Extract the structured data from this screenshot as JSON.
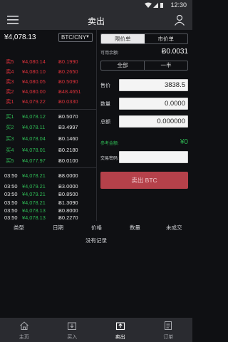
{
  "status": {
    "time": "12:30"
  },
  "header": {
    "title": "卖出"
  },
  "market": {
    "last_price": "¥4,078.13",
    "pair": "BTC/CNY"
  },
  "asks": [
    {
      "label": "卖5",
      "price": "¥4,080.14",
      "qty": "Ƀ0.1990"
    },
    {
      "label": "卖4",
      "price": "¥4,080.10",
      "qty": "Ƀ0.2650"
    },
    {
      "label": "卖3",
      "price": "¥4,080.05",
      "qty": "Ƀ0.5090"
    },
    {
      "label": "卖2",
      "price": "¥4,080.00",
      "qty": "Ƀ48.4651"
    },
    {
      "label": "卖1",
      "price": "¥4,079.22",
      "qty": "Ƀ0.0330"
    }
  ],
  "bids": [
    {
      "label": "买1",
      "price": "¥4,078.12",
      "qty": "Ƀ0.5070"
    },
    {
      "label": "买2",
      "price": "¥4,078.11",
      "qty": "Ƀ3.4997"
    },
    {
      "label": "买3",
      "price": "¥4,078.04",
      "qty": "Ƀ0.1460"
    },
    {
      "label": "买4",
      "price": "¥4,078.01",
      "qty": "Ƀ0.2180"
    },
    {
      "label": "买5",
      "price": "¥4,077.97",
      "qty": "Ƀ0.0100"
    }
  ],
  "trades": [
    {
      "time": "03:50",
      "price": "¥4,078.21",
      "qty": "Ƀ8.0000"
    },
    {
      "time": "03:50",
      "price": "¥4,079.21",
      "qty": "Ƀ3.0000"
    },
    {
      "time": "03:50",
      "price": "¥4,079.21",
      "qty": "Ƀ0.8500"
    },
    {
      "time": "03:50",
      "price": "¥4,078.21",
      "qty": "Ƀ1.3090"
    },
    {
      "time": "03:50",
      "price": "¥4,078.13",
      "qty": "Ƀ0.8000"
    },
    {
      "time": "03:50",
      "price": "¥4,078.13",
      "qty": "Ƀ0.2270"
    }
  ],
  "order_form": {
    "tab_limit": "限价单",
    "tab_market": "市价单",
    "available_label": "可用余额:",
    "available_value": "Ƀ0.0031",
    "btn_all": "全部",
    "btn_half": "一半",
    "price_label": "售价",
    "price_value": "3838.5",
    "qty_label": "数量",
    "qty_value": "0.0000",
    "total_label": "总额",
    "total_value": "0.000000",
    "ref_label": "参考金额:",
    "ref_value": "¥0",
    "pwd_label": "交易密码:",
    "sell_button": "卖出 BTC"
  },
  "orders": {
    "headers": [
      "类型",
      "日期",
      "价格",
      "数量",
      "未成交"
    ],
    "empty_text": "没有记录"
  },
  "nav": [
    {
      "label": "主页",
      "icon": "home-icon"
    },
    {
      "label": "买入",
      "icon": "buy-icon"
    },
    {
      "label": "卖出",
      "icon": "sell-icon",
      "active": true
    },
    {
      "label": "订单",
      "icon": "orders-icon"
    }
  ]
}
